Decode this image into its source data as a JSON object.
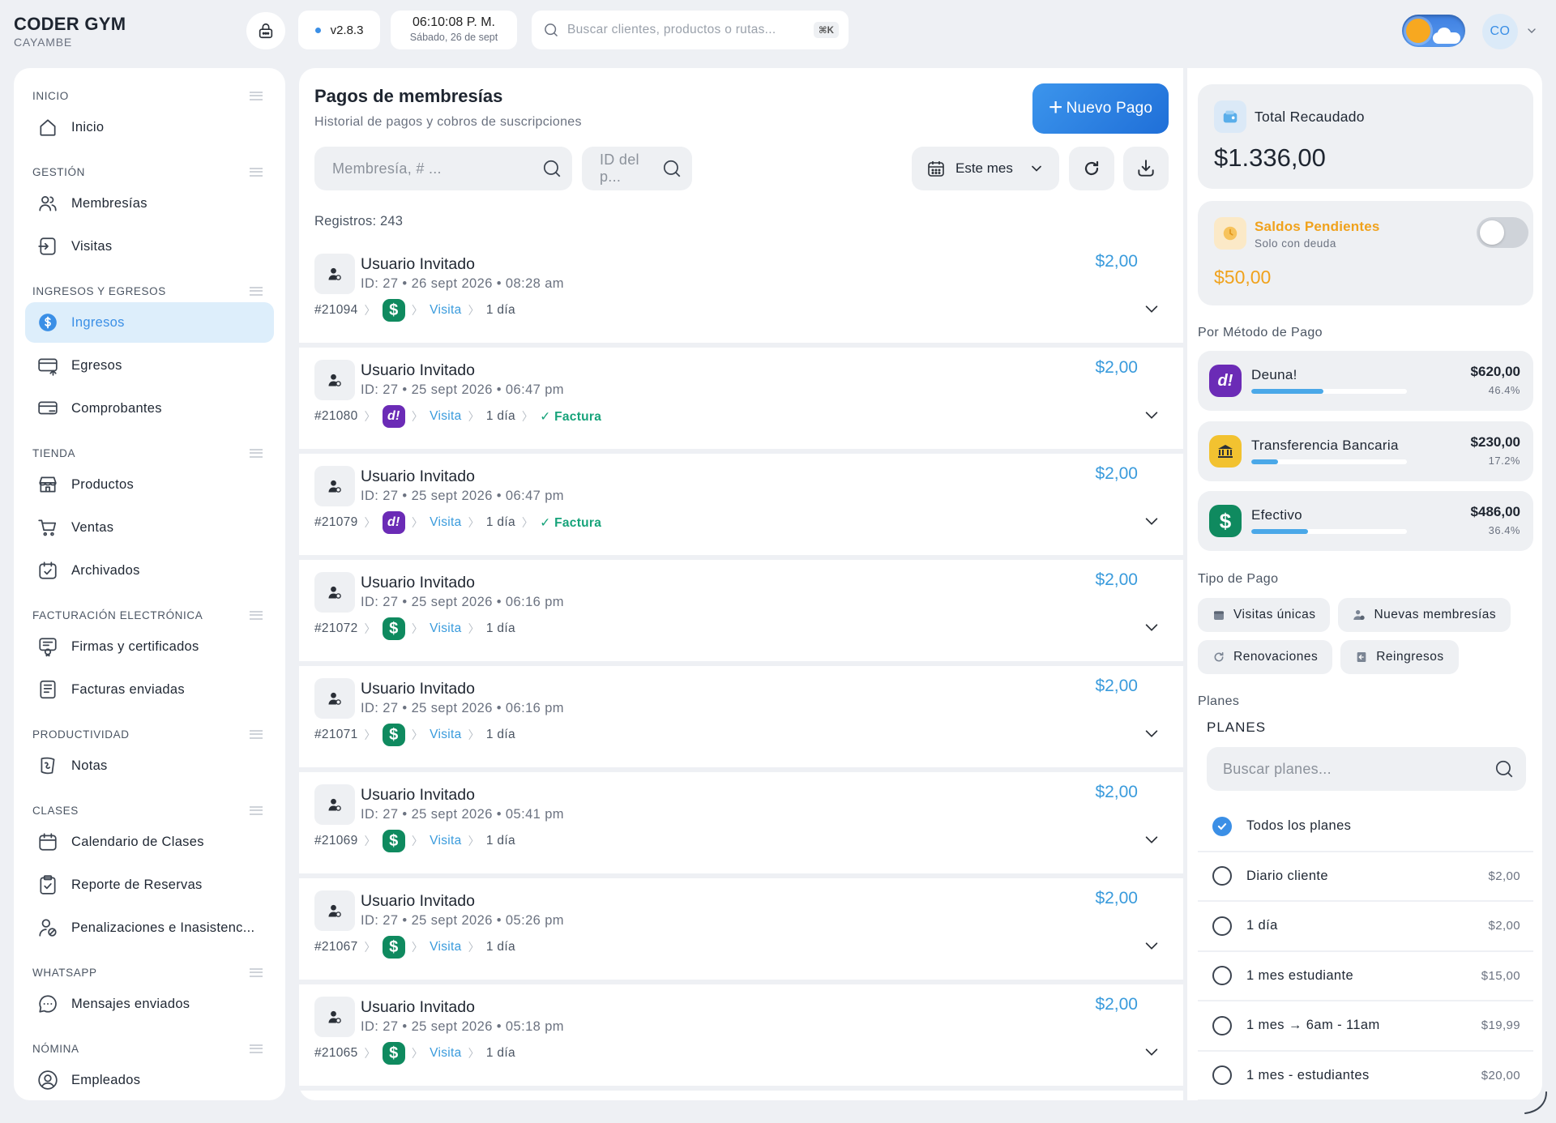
{
  "brand": {
    "name": "CODER GYM",
    "subtitle": "CAYAMBE"
  },
  "topbar": {
    "version": "v2.8.3",
    "clock_time": "06:10:08 P. M.",
    "clock_date": "Sábado, 26 de sept",
    "search_placeholder": "Buscar clientes, productos o rutas...",
    "search_shortcut": "⌘K",
    "avatar_initials": "CO"
  },
  "sidebar": {
    "sections": [
      {
        "title": "INICIO",
        "items": [
          {
            "label": "Inicio",
            "icon": "home-icon"
          }
        ]
      },
      {
        "title": "GESTIÓN",
        "items": [
          {
            "label": "Membresías",
            "icon": "users-icon"
          },
          {
            "label": "Visitas",
            "icon": "login-icon"
          }
        ]
      },
      {
        "title": "INGRESOS Y EGRESOS",
        "items": [
          {
            "label": "Ingresos",
            "icon": "dollar-circle-icon"
          },
          {
            "label": "Egresos",
            "icon": "card-out-icon"
          },
          {
            "label": "Comprobantes",
            "icon": "card-receipt-icon"
          }
        ]
      },
      {
        "title": "TIENDA",
        "items": [
          {
            "label": "Productos",
            "icon": "store-icon"
          },
          {
            "label": "Ventas",
            "icon": "cart-icon"
          },
          {
            "label": "Archivados",
            "icon": "archive-check-icon"
          }
        ]
      },
      {
        "title": "FACTURACIÓN ELECTRÓNICA",
        "items": [
          {
            "label": "Firmas y certificados",
            "icon": "certificate-icon"
          },
          {
            "label": "Facturas enviadas",
            "icon": "invoice-icon"
          }
        ]
      },
      {
        "title": "PRODUCTIVIDAD",
        "items": [
          {
            "label": "Notas",
            "icon": "notes-icon"
          }
        ]
      },
      {
        "title": "CLASES",
        "items": [
          {
            "label": "Calendario de Clases",
            "icon": "calendar-icon"
          },
          {
            "label": "Reporte de Reservas",
            "icon": "clipboard-check-icon"
          },
          {
            "label": "Penalizaciones e Inasistenc...",
            "icon": "user-penalty-icon"
          }
        ]
      },
      {
        "title": "WHATSAPP",
        "items": [
          {
            "label": "Mensajes enviados",
            "icon": "chat-icon"
          }
        ]
      },
      {
        "title": "NÓMINA",
        "items": [
          {
            "label": "Empleados",
            "icon": "user-circle-icon"
          }
        ]
      }
    ],
    "active": "Ingresos"
  },
  "main": {
    "title": "Pagos de membresías",
    "subtitle": "Historial de pagos y cobros de suscripciones",
    "new_button": "Nuevo Pago",
    "search_membership_placeholder": "Membresía, # ...",
    "search_id_placeholder": "ID del p...",
    "period": "Este mes",
    "records_label": "Registros: 243",
    "payments": [
      {
        "name": "Usuario Invitado",
        "meta": "ID: 27 • 26 sept 2026 • 08:28 am",
        "amount": "$2,00",
        "number": "#21094",
        "method": "cash",
        "type": "Visita",
        "plan": "1 día",
        "invoice": ""
      },
      {
        "name": "Usuario Invitado",
        "meta": "ID: 27 • 25 sept 2026 • 06:47 pm",
        "amount": "$2,00",
        "number": "#21080",
        "method": "deuna",
        "type": "Visita",
        "plan": "1 día",
        "invoice": "✓ Factura"
      },
      {
        "name": "Usuario Invitado",
        "meta": "ID: 27 • 25 sept 2026 • 06:47 pm",
        "amount": "$2,00",
        "number": "#21079",
        "method": "deuna",
        "type": "Visita",
        "plan": "1 día",
        "invoice": "✓ Factura"
      },
      {
        "name": "Usuario Invitado",
        "meta": "ID: 27 • 25 sept 2026 • 06:16 pm",
        "amount": "$2,00",
        "number": "#21072",
        "method": "cash",
        "type": "Visita",
        "plan": "1 día",
        "invoice": ""
      },
      {
        "name": "Usuario Invitado",
        "meta": "ID: 27 • 25 sept 2026 • 06:16 pm",
        "amount": "$2,00",
        "number": "#21071",
        "method": "cash",
        "type": "Visita",
        "plan": "1 día",
        "invoice": ""
      },
      {
        "name": "Usuario Invitado",
        "meta": "ID: 27 • 25 sept 2026 • 05:41 pm",
        "amount": "$2,00",
        "number": "#21069",
        "method": "cash",
        "type": "Visita",
        "plan": "1 día",
        "invoice": ""
      },
      {
        "name": "Usuario Invitado",
        "meta": "ID: 27 • 25 sept 2026 • 05:26 pm",
        "amount": "$2,00",
        "number": "#21067",
        "method": "cash",
        "type": "Visita",
        "plan": "1 día",
        "invoice": ""
      },
      {
        "name": "Usuario Invitado",
        "meta": "ID: 27 • 25 sept 2026 • 05:18 pm",
        "amount": "$2,00",
        "number": "#21065",
        "method": "cash",
        "type": "Visita",
        "plan": "1 día",
        "invoice": ""
      }
    ]
  },
  "summary": {
    "total_label": "Total Recaudado",
    "total_value": "$1.336,00",
    "pending_label": "Saldos Pendientes",
    "pending_sub": "Solo con deuda",
    "pending_value": "$50,00",
    "methods_title": "Por Método de Pago",
    "methods": [
      {
        "name": "Deuna!",
        "amount": "$620,00",
        "percent": "46.4%",
        "share": 0.464,
        "color": "#6b2bb6",
        "icon": "deuna-icon"
      },
      {
        "name": "Transferencia Bancaria",
        "amount": "$230,00",
        "percent": "17.2%",
        "share": 0.172,
        "color": "#f2c230",
        "icon": "bank-icon"
      },
      {
        "name": "Efectivo",
        "amount": "$486,00",
        "percent": "36.4%",
        "share": 0.364,
        "color": "#0f8a5f",
        "icon": "cash-icon"
      }
    ],
    "types_title": "Tipo de Pago",
    "types": [
      "Visitas únicas",
      "Nuevas membresías",
      "Renovaciones",
      "Reingresos"
    ],
    "plans_title": "Planes",
    "plans_head": "PLANES",
    "plans_search_placeholder": "Buscar planes...",
    "plans": [
      {
        "name": "Todos los planes",
        "price": "",
        "checked": true
      },
      {
        "name": "Diario cliente",
        "price": "$2,00",
        "checked": false
      },
      {
        "name": "1 día",
        "price": "$2,00",
        "checked": false
      },
      {
        "name": "1 mes estudiante",
        "price": "$15,00",
        "checked": false
      },
      {
        "name": "1 mes → 6am - 11am",
        "price": "$19,99",
        "checked": false
      },
      {
        "name": "1 mes - estudiantes",
        "price": "$20,00",
        "checked": false
      }
    ]
  },
  "colors": {
    "accent": "#3b8fe6",
    "amount": "#3a9bdc",
    "pending": "#f0a21c",
    "invoice": "#16a37a"
  }
}
